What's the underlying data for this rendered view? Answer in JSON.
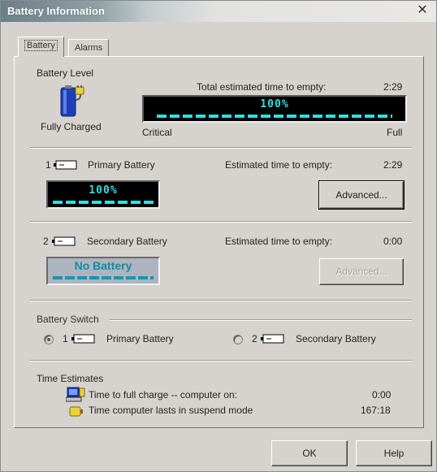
{
  "window": {
    "title": "Battery Information",
    "close_icon": "close-icon"
  },
  "tabs": [
    {
      "label": "Battery",
      "active": true
    },
    {
      "label": "Alarms",
      "active": false
    }
  ],
  "battery_level": {
    "group_title": "Battery Level",
    "status_text": "Fully Charged",
    "total_time_label": "Total estimated time to empty:",
    "total_time_value": "2:29",
    "meter_percent": "100%",
    "meter_fill": 1.0,
    "scale_left": "Critical",
    "scale_right": "Full",
    "icon": "battery-plug-icon"
  },
  "primary": {
    "index": "1",
    "label": "Primary Battery",
    "time_label": "Estimated time to empty:",
    "time_value": "2:29",
    "meter_percent": "100%",
    "advanced_label": "Advanced...",
    "advanced_enabled": true
  },
  "secondary": {
    "index": "2",
    "label": "Secondary Battery",
    "time_label": "Estimated time to empty:",
    "time_value": "0:00",
    "meter_text": "No Battery",
    "advanced_label": "Advanced...",
    "advanced_enabled": false
  },
  "switch": {
    "group_title": "Battery Switch",
    "option1_index": "1",
    "option1_label": "Primary Battery",
    "option1_selected": true,
    "option2_index": "2",
    "option2_label": "Secondary Battery",
    "option2_selected": false
  },
  "estimates": {
    "group_title": "Time Estimates",
    "row1_label": "Time to full charge -- computer on:",
    "row1_value": "0:00",
    "row1_icon": "computer-battery-icon",
    "row2_label": "Time computer lasts in suspend mode",
    "row2_value": "167:18",
    "row2_icon": "suspend-moon-icon"
  },
  "buttons": {
    "ok": "OK",
    "help": "Help"
  },
  "colors": {
    "meter_bg": "#000000",
    "meter_fg": "#2fe0e0",
    "face": "#d6d3ce",
    "no_battery_bg": "#aeb4bf"
  }
}
